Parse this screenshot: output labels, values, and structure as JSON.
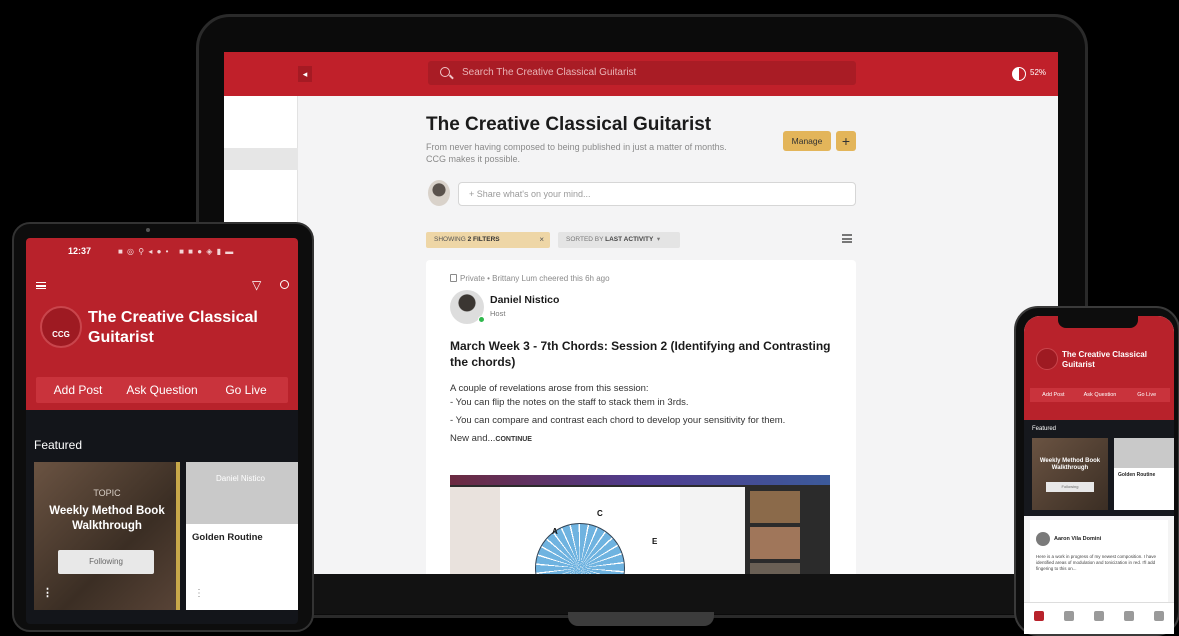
{
  "laptop": {
    "search_placeholder": "Search The Creative Classical Guitarist",
    "zoom": "52%",
    "community_title": "The Creative Classical Guitarist",
    "community_desc": "From never having composed to being published in just a matter of months. CCG makes it possible.",
    "manage_label": "Manage",
    "add_label": "+",
    "share_placeholder": "+ Share what's on your mind...",
    "filter_prefix": "SHOWING",
    "filter_bold": "2 FILTERS",
    "filter_close": "×",
    "sort_prefix": "SORTED BY",
    "sort_bold": "LAST ACTIVITY",
    "post": {
      "meta": "Private • Brittany Lum cheered this 6h ago",
      "author": "Daniel Nistico",
      "role": "Host",
      "title": "March Week 3 - 7th Chords: Session 2 (Identifying and Contrasting the chords)",
      "line1": "A couple of revelations arose from this session:",
      "line2": "- You can flip the notes on the staff to stack them in 3rds.",
      "line3": "- You can compare and contrast each chord to develop your sensitivity for them.",
      "line4_text": "New and...",
      "line4_more": "CONTINUE",
      "video_letters": [
        "C",
        "A",
        "E"
      ]
    }
  },
  "tablet": {
    "time": "12:37",
    "title": "The Creative Classical Guitarist",
    "logo_text": "CCG",
    "actions": [
      "Add Post",
      "Ask Question",
      "Go Live"
    ],
    "featured_label": "Featured",
    "card1": {
      "topic": "TOPIC",
      "title": "Weekly Method Book Walkthrough",
      "following": "Following"
    },
    "card2": {
      "user": "Daniel Nistico",
      "title": "Golden Routine"
    }
  },
  "phone": {
    "title": "The Creative Classical Guitarist",
    "actions": [
      "Add Post",
      "Ask Question",
      "Go Live"
    ],
    "featured_label": "Featured",
    "card1": {
      "title": "Weekly Method Book Walkthrough",
      "following": "Following"
    },
    "card2": {
      "title": "Golden Routine"
    },
    "post": {
      "author": "Aaron Vila Domini",
      "body": "Here is a work in progress of my newest composition. I have identified areas of modulation and tonicization in red. I'll add fingering to this on..."
    },
    "tabs": [
      "home",
      "explore",
      "messages",
      "notifications",
      "profile"
    ]
  },
  "colors": {
    "brand": "#c0202a",
    "accent": "#e3b55a",
    "dark": "#13151a"
  }
}
